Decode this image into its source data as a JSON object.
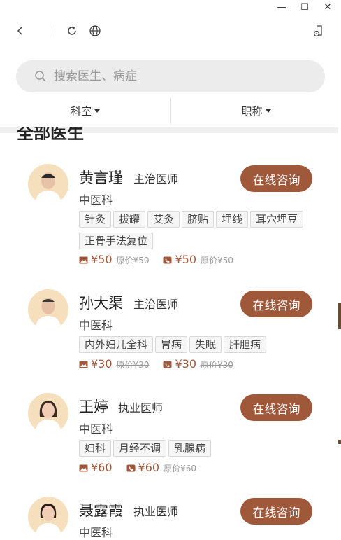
{
  "window": {
    "minimize": "—",
    "maximize": "☐",
    "close": "✕"
  },
  "search": {
    "placeholder": "搜索医生、病症"
  },
  "filters": [
    {
      "label": "科室"
    },
    {
      "label": "职称"
    }
  ],
  "section": {
    "title": "全部医生"
  },
  "doctors": [
    {
      "name": "黄言瑾",
      "title": "主治医师",
      "dept": "中医科",
      "consult": "在线咨询",
      "tags": [
        "针灸",
        "拔罐",
        "艾灸",
        "脐贴",
        "埋线",
        "耳穴埋豆",
        "正骨手法复位"
      ],
      "prices": [
        {
          "type": "image",
          "now": "¥50",
          "orig": "原价¥50"
        },
        {
          "type": "phone",
          "now": "¥50",
          "orig": "原价¥50"
        }
      ]
    },
    {
      "name": "孙大渠",
      "title": "主治医师",
      "dept": "中医科",
      "consult": "在线咨询",
      "tags": [
        "内外妇儿全科",
        "胃病",
        "失眠",
        "肝胆病"
      ],
      "prices": [
        {
          "type": "image",
          "now": "¥30",
          "orig": "原价¥30"
        },
        {
          "type": "phone",
          "now": "¥30",
          "orig": "原价¥30"
        }
      ]
    },
    {
      "name": "王婷",
      "title": "执业医师",
      "dept": "中医科",
      "consult": "在线咨询",
      "tags": [
        "妇科",
        "月经不调",
        "乳腺病"
      ],
      "prices": [
        {
          "type": "image",
          "now": "¥60",
          "orig": ""
        },
        {
          "type": "phone",
          "now": "¥60",
          "orig": "原价¥60"
        }
      ]
    },
    {
      "name": "聂露霞",
      "title": "执业医师",
      "dept": "中医科",
      "consult": "在线咨询",
      "tags": [],
      "prices": []
    }
  ],
  "colors": {
    "accent": "#a0583b",
    "avatar_bg": "#f6dfbd",
    "search_bg": "#ececec"
  }
}
